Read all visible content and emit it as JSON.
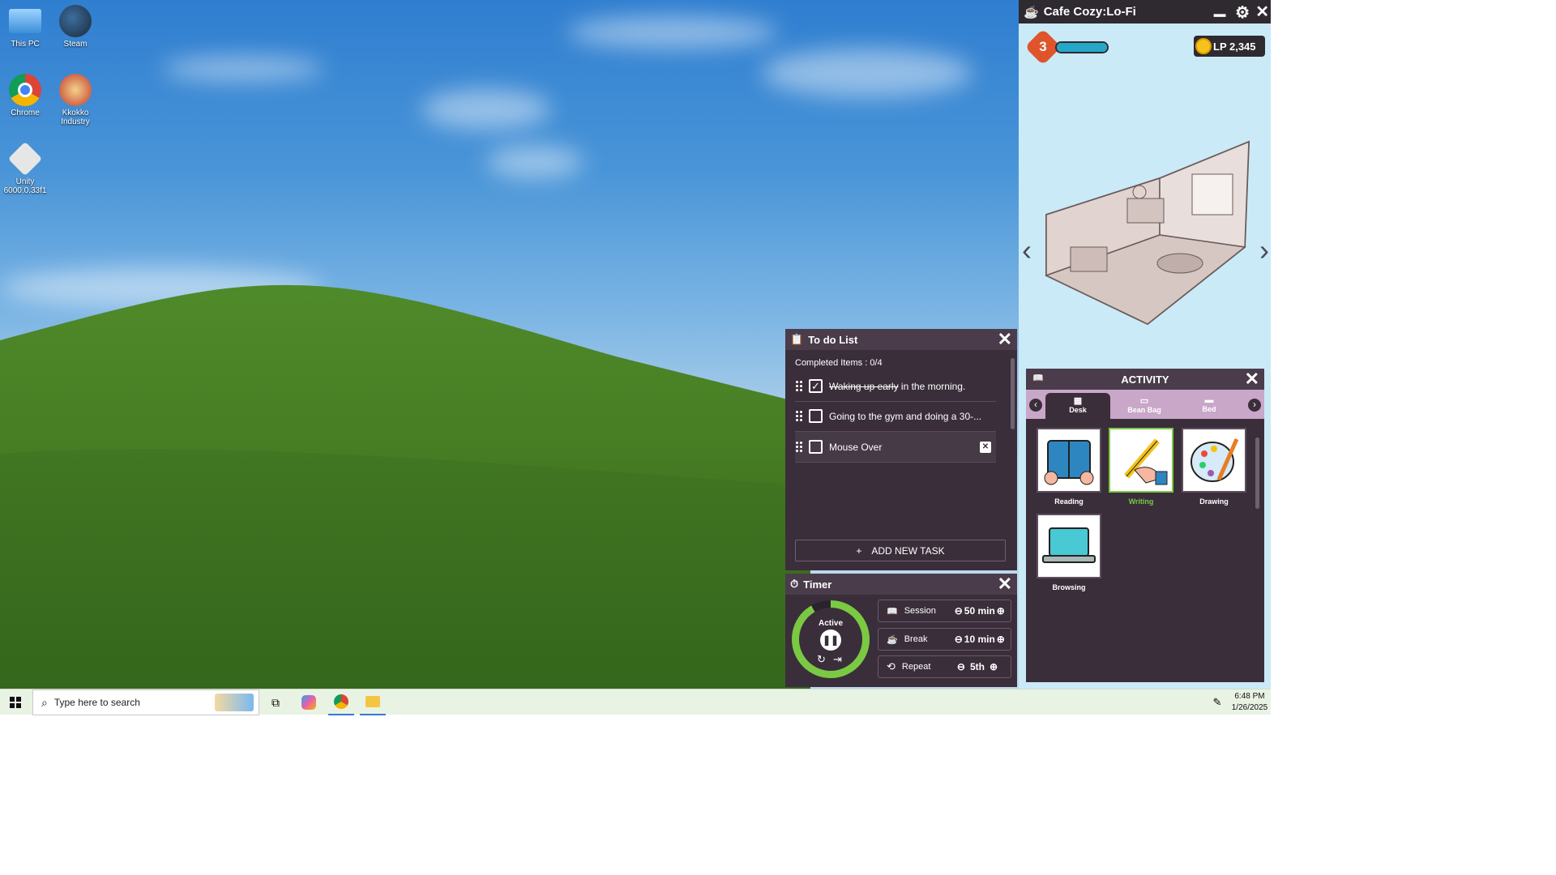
{
  "desktop": {
    "icons": [
      {
        "label": "This PC"
      },
      {
        "label": "Steam"
      },
      {
        "label": "Chrome"
      },
      {
        "label": "Kkokko Industry"
      },
      {
        "label": "Unity 6000.0.33f1"
      }
    ]
  },
  "cafe": {
    "title": "Cafe Cozy:Lo-Fi",
    "level": "3",
    "level_progress": 1.0,
    "points": "LP 2,345"
  },
  "todo": {
    "title": "To do List",
    "completed": "Completed Items : 0/4",
    "tasks": [
      {
        "struck": "Waking up early",
        "rest": " in the morning.",
        "checked": true
      },
      {
        "struck": "",
        "rest": "Going to the gym and doing a 30-...",
        "checked": false
      },
      {
        "struck": "",
        "rest": "Mouse Over",
        "checked": false
      }
    ],
    "add_label": "ADD NEW TASK"
  },
  "timer": {
    "title": "Timer",
    "status": "Active",
    "session_label": "Session",
    "session_value": "50 min",
    "break_label": "Break",
    "break_value": "10 min",
    "repeat_label": "Repeat",
    "repeat_value": "5th"
  },
  "activity": {
    "title": "ACTIVITY",
    "tabs": [
      {
        "label": "Desk"
      },
      {
        "label": "Bean Bag"
      },
      {
        "label": "Bed"
      }
    ],
    "items": [
      {
        "label": "Reading"
      },
      {
        "label": "Writing"
      },
      {
        "label": "Drawing"
      },
      {
        "label": "Browsing"
      }
    ]
  },
  "taskbar": {
    "search_placeholder": "Type here to search",
    "time": "6:48 PM",
    "date": "1/26/2025"
  },
  "colors": {
    "accent_green": "#7ac943",
    "panel": "#3a2e3a",
    "level_bar": "#24a7c9"
  }
}
